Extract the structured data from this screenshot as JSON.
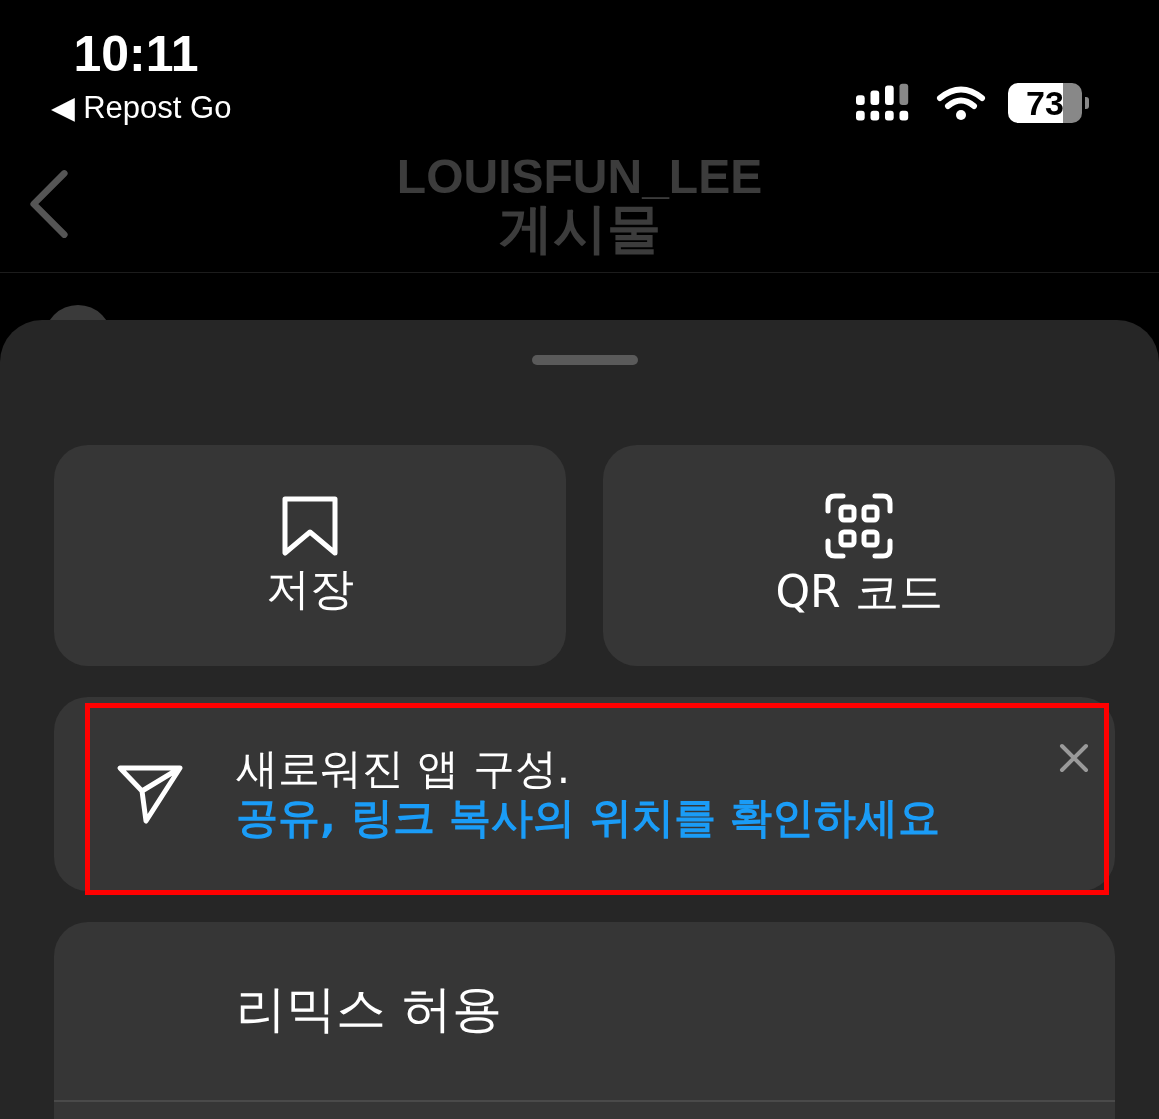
{
  "status_bar": {
    "time": "10:11",
    "back_app": "◀ Repost Go",
    "battery": "73"
  },
  "header": {
    "title": "LOUISFUN_LEE",
    "subtitle": "게시물"
  },
  "post": {
    "kind": "avatar"
  },
  "sheet": {
    "tiles": [
      {
        "kind": "bookmark",
        "label": "저장"
      },
      {
        "kind": "qr",
        "label": "QR 코드"
      }
    ],
    "banner": {
      "title": "새로워진 앱 구성.",
      "message": "공유, 링크 복사의 위치를 확인하세요",
      "highlighted": true
    },
    "options": [
      {
        "label": "리믹스 허용"
      }
    ]
  }
}
